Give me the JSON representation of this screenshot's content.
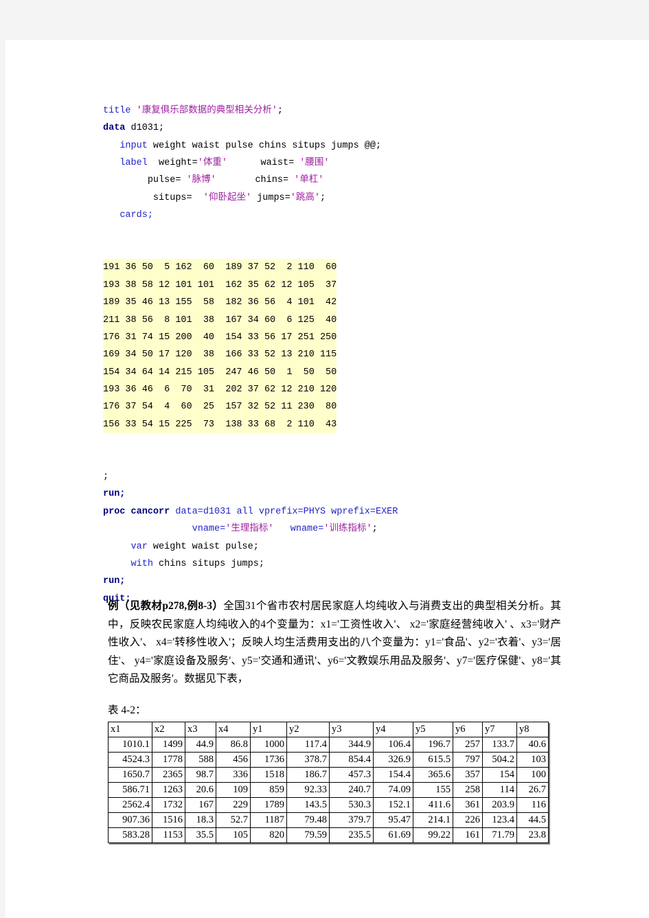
{
  "document": {
    "type": "word-document-page",
    "background_color": "#ffffff",
    "surround_color": "#f4f4f4",
    "highlight_color": "#ffffcc"
  },
  "code": {
    "language": "SAS",
    "lines": [
      {
        "indent": 0,
        "parts": [
          {
            "t": "title ",
            "c": "kw-blue"
          },
          {
            "t": "'康复俱乐部数据的典型相关分析'",
            "c": "str"
          },
          {
            "t": ";",
            "c": "plain"
          }
        ]
      },
      {
        "indent": 0,
        "parts": [
          {
            "t": "data",
            "c": "kw-navy"
          },
          {
            "t": " d1031;",
            "c": "plain"
          }
        ]
      },
      {
        "indent": 3,
        "parts": [
          {
            "t": "input",
            "c": "kw-blue"
          },
          {
            "t": " weight waist pulse chins situps jumps @@;",
            "c": "plain"
          }
        ]
      },
      {
        "indent": 3,
        "parts": [
          {
            "t": "label",
            "c": "kw-blue"
          },
          {
            "t": "  weight=",
            "c": "plain"
          },
          {
            "t": "'体重'",
            "c": "str"
          },
          {
            "t": "      waist= ",
            "c": "plain"
          },
          {
            "t": "'腰围'",
            "c": "str"
          }
        ]
      },
      {
        "indent": 8,
        "parts": [
          {
            "t": "pulse= ",
            "c": "plain"
          },
          {
            "t": "'脉博'",
            "c": "str"
          },
          {
            "t": "       chins= ",
            "c": "plain"
          },
          {
            "t": "'单杠'",
            "c": "str"
          }
        ]
      },
      {
        "indent": 9,
        "parts": [
          {
            "t": "situps=  ",
            "c": "plain"
          },
          {
            "t": "'仰卧起坐'",
            "c": "str"
          },
          {
            "t": " jumps=",
            "c": "plain"
          },
          {
            "t": "'跳高'",
            "c": "str"
          },
          {
            "t": ";",
            "c": "plain"
          }
        ]
      },
      {
        "indent": 3,
        "parts": [
          {
            "t": "cards;",
            "c": "kw-blue"
          }
        ]
      }
    ],
    "data_rows": [
      "191 36 50  5 162  60  189 37 52  2 110  60",
      "193 38 58 12 101 101  162 35 62 12 105  37",
      "189 35 46 13 155  58  182 36 56  4 101  42",
      "211 38 56  8 101  38  167 34 60  6 125  40",
      "176 31 74 15 200  40  154 33 56 17 251 250",
      "169 34 50 17 120  38  166 33 52 13 210 115",
      "154 34 64 14 215 105  247 46 50  1  50  50",
      "193 36 46  6  70  31  202 37 62 12 210 120",
      "176 37 54  4  60  25  157 32 52 11 230  80",
      "156 33 54 15 225  73  138 33 68  2 110  43"
    ],
    "lines_after": [
      {
        "indent": 0,
        "parts": [
          {
            "t": ";",
            "c": "plain"
          }
        ]
      },
      {
        "indent": 0,
        "parts": [
          {
            "t": "run;",
            "c": "kw-navy"
          }
        ]
      },
      {
        "indent": 0,
        "parts": [
          {
            "t": "proc cancorr",
            "c": "kw-proc"
          },
          {
            "t": " ",
            "c": "plain"
          },
          {
            "t": "data=d1031 all vprefix=PHYS wprefix=EXER",
            "c": "kw-blue"
          }
        ]
      },
      {
        "indent": 16,
        "parts": [
          {
            "t": "vname=",
            "c": "kw-blue"
          },
          {
            "t": "'生理指标'",
            "c": "str"
          },
          {
            "t": "   ",
            "c": "plain"
          },
          {
            "t": "wname=",
            "c": "kw-blue"
          },
          {
            "t": "'训练指标'",
            "c": "str"
          },
          {
            "t": ";",
            "c": "plain"
          }
        ]
      },
      {
        "indent": 5,
        "parts": [
          {
            "t": "var",
            "c": "kw-blue"
          },
          {
            "t": " weight waist pulse;",
            "c": "plain"
          }
        ]
      },
      {
        "indent": 5,
        "parts": [
          {
            "t": "with",
            "c": "kw-blue"
          },
          {
            "t": " chins situps jumps;",
            "c": "plain"
          }
        ]
      },
      {
        "indent": 0,
        "parts": [
          {
            "t": "run;",
            "c": "kw-navy"
          }
        ]
      },
      {
        "indent": 0,
        "parts": [
          {
            "t": "quit;",
            "c": "kw-navy"
          }
        ]
      }
    ]
  },
  "paragraph": {
    "lead_bold": "例（见教材p278,例8-3）",
    "body": "全国31个省市农村居民家庭人均纯收入与消费支出的典型相关分析。其中，反映农民家庭人均纯收入的4个变量为：x1='工资性收入'、 x2='家庭经营纯收入' 、x3='财产性收入'、 x4='转移性收入'；反映人均生活费用支出的八个变量为：y1='食品'、y2='衣着'、y3='居住'、 y4='家庭设备及服务'、y5='交通和通讯'、y6='文教娱乐用品及服务'、y7='医疗保健'、y8='其它商品及服务'。数据见下表，"
  },
  "table_caption": "表 4-2：",
  "chart_data": {
    "type": "table",
    "title": "表 4-2：",
    "columns": [
      "x1",
      "x2",
      "x3",
      "x4",
      "y1",
      "y2",
      "y3",
      "y4",
      "y5",
      "y6",
      "y7",
      "y8"
    ],
    "rows": [
      [
        "1010.1",
        "1499",
        "44.9",
        "86.8",
        "1000",
        "117.4",
        "344.9",
        "106.4",
        "196.7",
        "257",
        "133.7",
        "40.6"
      ],
      [
        "4524.3",
        "1778",
        "588",
        "456",
        "1736",
        "378.7",
        "854.4",
        "326.9",
        "615.5",
        "797",
        "504.2",
        "103"
      ],
      [
        "1650.7",
        "2365",
        "98.7",
        "336",
        "1518",
        "186.7",
        "457.3",
        "154.4",
        "365.6",
        "357",
        "154",
        "100"
      ],
      [
        "586.71",
        "1263",
        "20.6",
        "109",
        "859",
        "92.33",
        "240.7",
        "74.09",
        "155",
        "258",
        "114",
        "26.7"
      ],
      [
        "2562.4",
        "1732",
        "167",
        "229",
        "1789",
        "143.5",
        "530.3",
        "152.1",
        "411.6",
        "361",
        "203.9",
        "116"
      ],
      [
        "907.36",
        "1516",
        "18.3",
        "52.7",
        "1187",
        "79.48",
        "379.7",
        "95.47",
        "214.1",
        "226",
        "123.4",
        "44.5"
      ],
      [
        "583.28",
        "1153",
        "35.5",
        "105",
        "820",
        "79.59",
        "235.5",
        "61.69",
        "99.22",
        "161",
        "71.79",
        "23.8"
      ]
    ]
  }
}
